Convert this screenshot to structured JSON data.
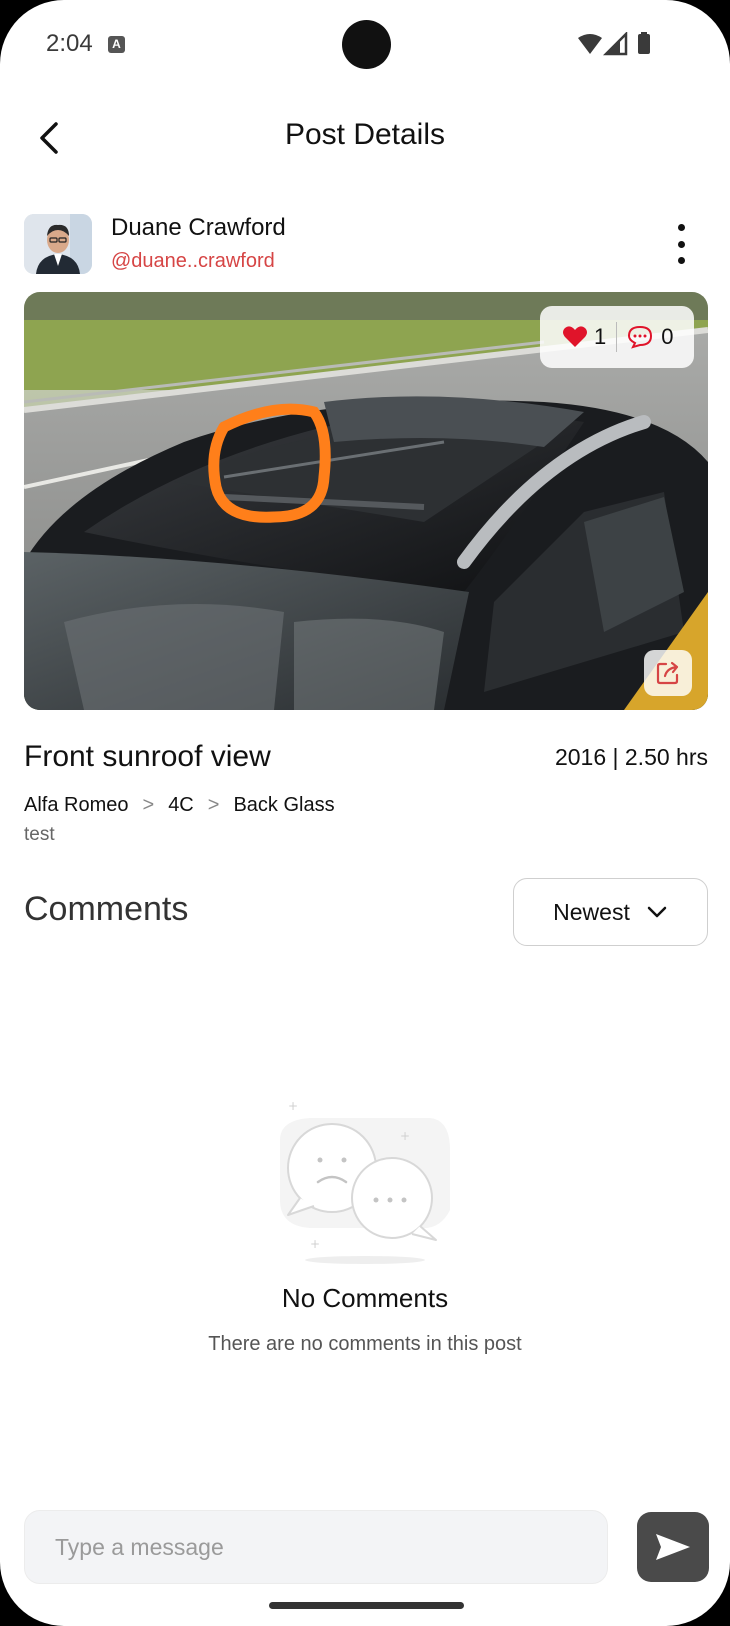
{
  "status_bar": {
    "time": "2:04",
    "notification_icon": "a-icon",
    "icons": [
      "wifi-icon",
      "signal-icon",
      "battery-icon"
    ]
  },
  "header": {
    "title": "Post Details",
    "back_icon": "chevron-left-icon"
  },
  "author": {
    "name": "Duane Crawford",
    "handle": "@duane..crawford",
    "menu_icon": "more-vertical-icon"
  },
  "post": {
    "likes": "1",
    "comments_count": "0",
    "title": "Front sunroof view",
    "meta": "2016 | 2.50 hrs",
    "breadcrumb": [
      "Alfa Romeo",
      "4C",
      "Back Glass"
    ],
    "breadcrumb_separator": ">",
    "description": "test"
  },
  "comments": {
    "title": "Comments",
    "sort_selected": "Newest",
    "empty_title": "No Comments",
    "empty_subtitle": "There are no comments in this post"
  },
  "composer": {
    "placeholder": "Type a message"
  },
  "colors": {
    "accent": "#d64545",
    "heart": "#e0142a",
    "send_button": "#4a4a4a",
    "annotation": "#ff7f1a"
  }
}
